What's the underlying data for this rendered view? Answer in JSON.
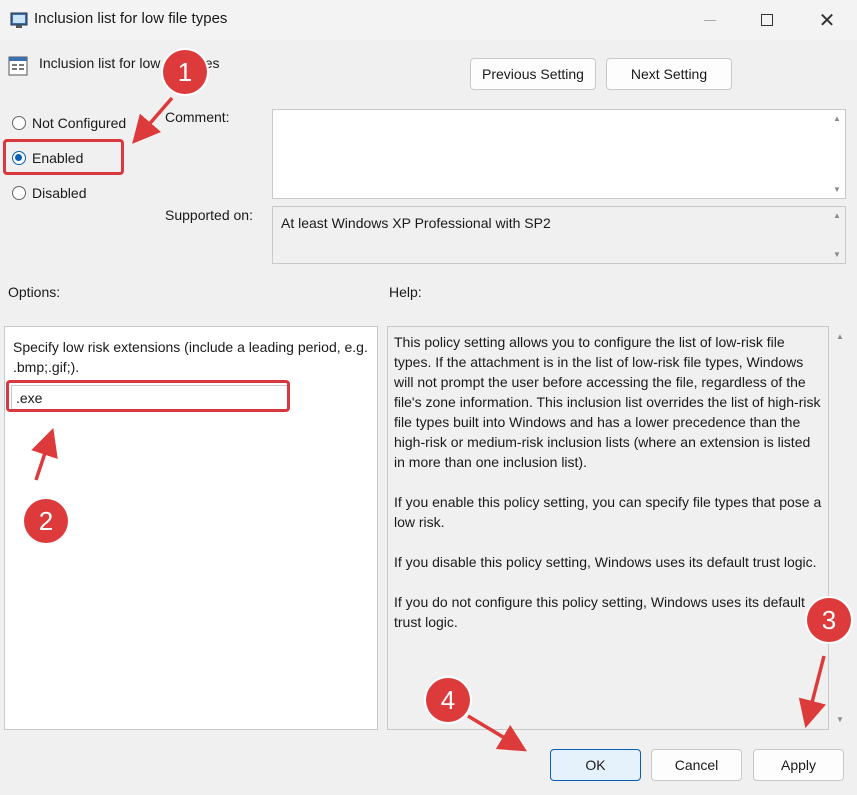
{
  "window": {
    "title": "Inclusion list for low file types",
    "header_label": "Inclusion list for low file types"
  },
  "nav": {
    "previous": "Previous Setting",
    "next": "Next Setting"
  },
  "state": {
    "options": [
      "Not Configured",
      "Enabled",
      "Disabled"
    ],
    "selected": "Enabled"
  },
  "comment": {
    "label": "Comment:",
    "value": ""
  },
  "supported": {
    "label": "Supported on:",
    "value": "At least Windows XP Professional with SP2"
  },
  "options_panel": {
    "label": "Options:",
    "instruction": "Specify low risk extensions (include a leading period, e.g. .bmp;.gif;).",
    "field_value": ".exe"
  },
  "help": {
    "label": "Help:",
    "paragraphs": [
      "This policy setting allows you to configure the list of low-risk file types. If the attachment is in the list of low-risk file types, Windows will not prompt the user before accessing the file, regardless of the file's zone information. This inclusion list overrides the list of high-risk file types built into Windows and has a lower precedence than the high-risk or medium-risk inclusion lists (where an extension is listed in more than one inclusion list).",
      "If you enable this policy setting, you can specify file types that pose a low risk.",
      "If you disable this policy setting, Windows uses its default trust logic.",
      "If you do not configure this policy setting, Windows uses its default trust logic."
    ]
  },
  "footer": {
    "ok": "OK",
    "cancel": "Cancel",
    "apply": "Apply"
  },
  "annotations": [
    "1",
    "2",
    "3",
    "4"
  ],
  "colors": {
    "accent": "#0a5fb4",
    "annotation_red": "#dd3b3b"
  }
}
